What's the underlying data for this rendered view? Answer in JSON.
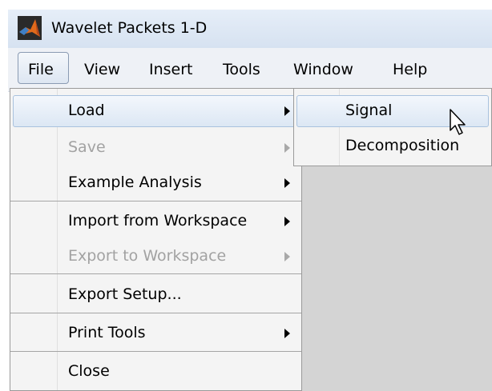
{
  "window": {
    "title": "Wavelet Packets 1-D",
    "logo_icon": "matlab-logo-icon"
  },
  "menubar": {
    "items": [
      {
        "label": "File"
      },
      {
        "label": "View"
      },
      {
        "label": "Insert"
      },
      {
        "label": "Tools"
      },
      {
        "label": "Window"
      },
      {
        "label": "Help"
      }
    ]
  },
  "file_menu": {
    "items": [
      {
        "label": "Load",
        "submenu": true,
        "highlighted": true
      },
      {
        "label": "Save",
        "submenu": true,
        "disabled": true
      },
      {
        "label": "Example Analysis",
        "submenu": true
      },
      {
        "label": "Import from Workspace",
        "submenu": true
      },
      {
        "label": "Export to Workspace",
        "submenu": true,
        "disabled": true
      },
      {
        "label": "Export Setup..."
      },
      {
        "label": "Print Tools",
        "submenu": true
      },
      {
        "label": "Close"
      }
    ]
  },
  "load_submenu": {
    "items": [
      {
        "label": "Signal",
        "highlighted": true
      },
      {
        "label": "Decomposition"
      }
    ]
  },
  "colors": {
    "highlight_border": "#a9c2de",
    "disabled_text": "#a2a2a2",
    "menu_background": "#f4f4f4",
    "workspace_background": "#d4d4d4"
  }
}
